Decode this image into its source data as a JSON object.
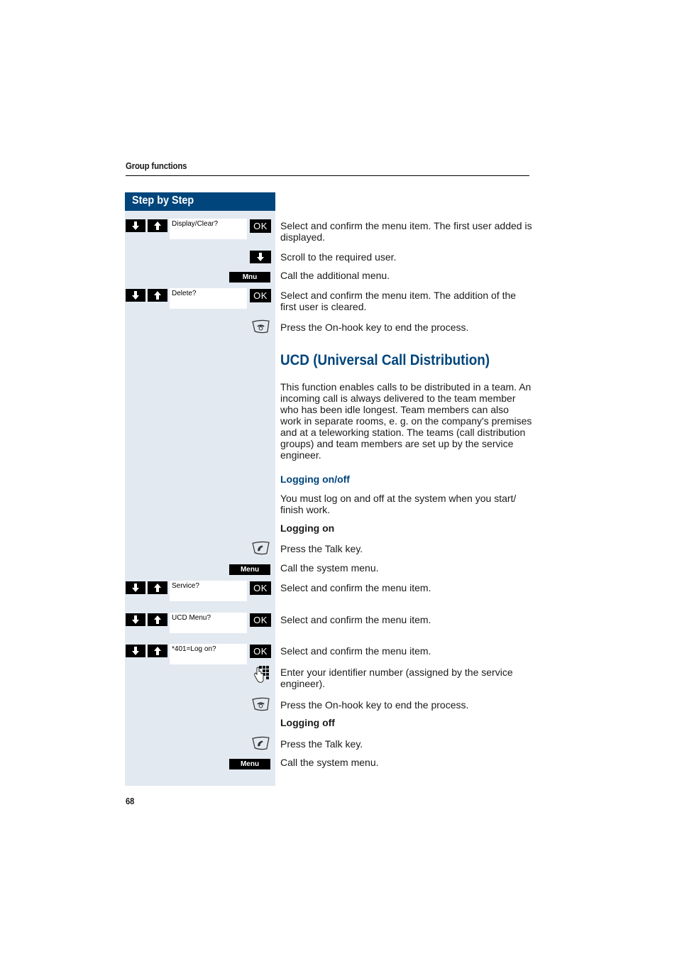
{
  "header": {
    "section_title": "Group functions"
  },
  "sidebar": {
    "title": "Step by Step"
  },
  "steps": {
    "display_clear": {
      "display": "Display/Clear?",
      "ok": "OK",
      "text": "Select and confirm the menu item. The first user added is displayed."
    },
    "scroll": {
      "text": "Scroll to the required user."
    },
    "mnu": {
      "key": "Mnu",
      "text": "Call the additional menu."
    },
    "delete": {
      "display": "Delete?",
      "ok": "OK",
      "text": "Select and confirm the menu item. The addition of the first user is cleared."
    },
    "onhook1": {
      "text": "Press the On-hook key to end the process."
    },
    "talk1": {
      "text": "Press the Talk key."
    },
    "menu1": {
      "key": "Menu",
      "text": "Call the system menu."
    },
    "service": {
      "display": "Service?",
      "ok": "OK",
      "text": "Select and confirm the menu item."
    },
    "ucd_menu": {
      "display": "UCD Menu?",
      "ok": "OK",
      "text": "Select and confirm the menu item."
    },
    "log_on": {
      "display": "*401=Log on?",
      "ok": "OK",
      "text": "Select and confirm the menu item."
    },
    "identifier": {
      "text": "Enter your identifier number (assigned by the service engineer)."
    },
    "onhook2": {
      "text": "Press the On-hook key to end the process."
    },
    "talk2": {
      "text": "Press the Talk key."
    },
    "menu2": {
      "key": "Menu",
      "text": "Call the system menu."
    }
  },
  "content": {
    "heading": "UCD (Universal Call Distribution)",
    "intro": "This function enables calls to be distributed in a team. An incoming call is always delivered to the team member who has been idle longest. Team members can also work in separate rooms, e. g. on the company's premises and at a teleworking station. The teams (call distribution groups) and team members are set up by the service engineer.",
    "subheading": "Logging on/off",
    "subintro": "You must log on and off at the system when you start/ finish work.",
    "logging_on": "Logging on",
    "logging_off": "Logging off"
  },
  "icons": {
    "down": "arrow-down-icon",
    "up": "arrow-up-icon",
    "onhook": "on-hook-key-icon",
    "talk": "talk-key-icon",
    "keypad": "keypad-icon"
  },
  "colors": {
    "brand_blue": "#00457c",
    "sidebar_bg": "#e3e9f1"
  },
  "footer": {
    "page_number": "68"
  }
}
